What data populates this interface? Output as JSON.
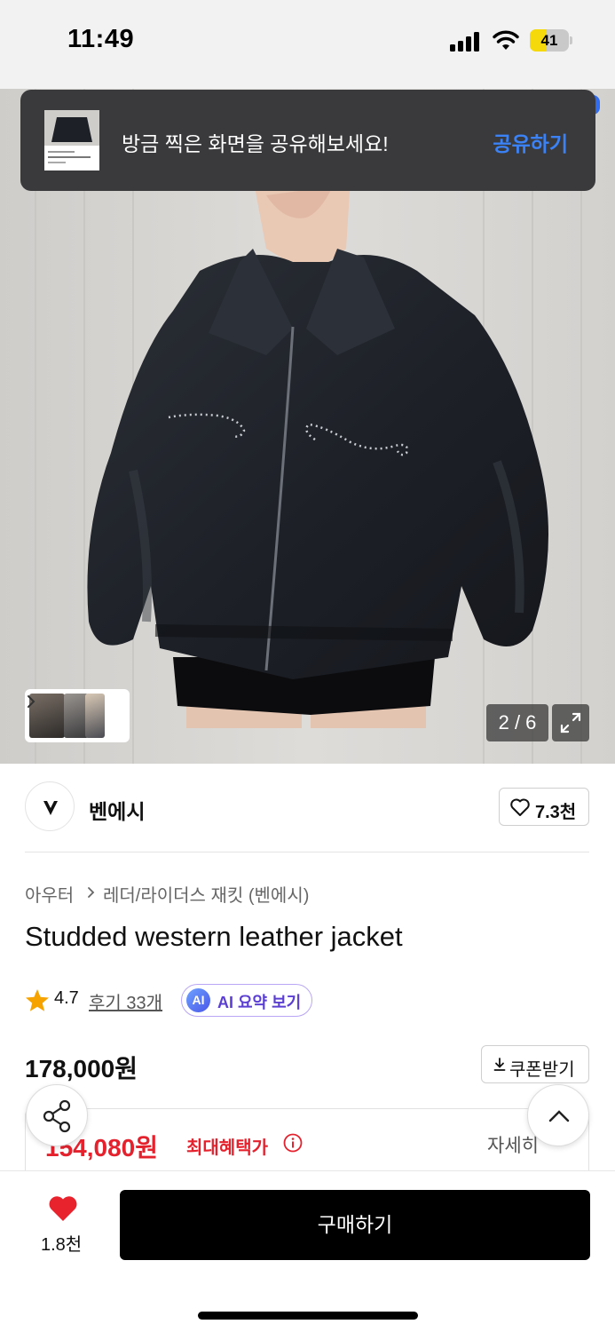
{
  "status_bar": {
    "time": "11:49",
    "battery": "41",
    "battery_level": 0.41
  },
  "toast": {
    "message": "방금 찍은 화면을 공유해보세요!",
    "action": "공유하기"
  },
  "gallery": {
    "counter": "2 / 6"
  },
  "brand": {
    "name": "벤에시",
    "like_count": "7.3천"
  },
  "breadcrumb": {
    "category": "아우터",
    "subcategory": "레더/라이더스 재킷 (벤에시)"
  },
  "product": {
    "title": "Studded western leather jacket",
    "rating": "4.7",
    "reviews": "후기 33개",
    "ai_summary": "AI 요약 보기",
    "ai_badge": "AI",
    "price": "178,000원",
    "coupon": "쿠폰받기",
    "benefit_price": "154,080원",
    "benefit_label": "최대혜택가",
    "benefit_detail": "자세히"
  },
  "bottom_bar": {
    "wishlist_count": "1.8천",
    "buy_label": "구매하기"
  },
  "colors": {
    "accent_blue": "#3b82f6",
    "price_red": "#e4222e",
    "heart_red": "#e8232d",
    "ai_purple": "#5b3fd3"
  }
}
